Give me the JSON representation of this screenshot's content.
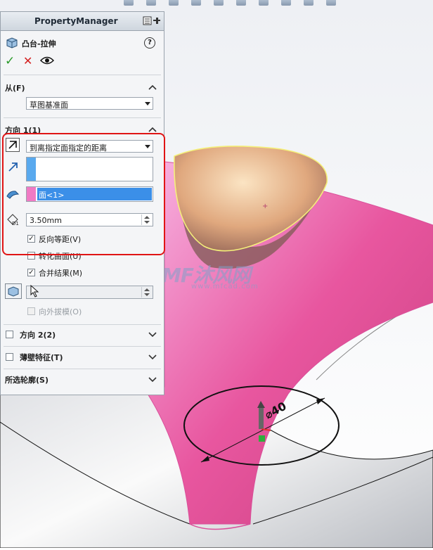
{
  "app": {
    "panel_title": "PropertyManager"
  },
  "feature": {
    "title": "凸台-拉伸"
  },
  "from": {
    "title": "从(F)",
    "selected": "草图基准面"
  },
  "direction1": {
    "title": "方向 1(1)",
    "end_condition": "到离指定面指定的距离",
    "face_selection": "面<1>",
    "offset_distance": "3.50mm",
    "reverse_offset_label": "反向等距(V)",
    "reverse_offset_checked": true
  },
  "options": {
    "translate_surface_label": "转化曲面(U)",
    "translate_surface_checked": false,
    "merge_result_label": "合并结果(M)",
    "merge_result_checked": true,
    "draft_outward_label": "向外拔模(O)",
    "draft_outward_checked": false
  },
  "direction2": {
    "title": "方向 2(2)",
    "checked": false
  },
  "thin_feature": {
    "title": "薄壁特征(T)",
    "checked": false
  },
  "selected_contours": {
    "title": "所选轮廓(S)"
  },
  "viewport": {
    "dimension_text": "⌀40",
    "watermark_logo": "MF沐风网",
    "watermark_url": "www.mfcad.com"
  },
  "colors": {
    "accent_red": "#e01515",
    "model_pink": "#ee6fc4",
    "face_yellow": "#e6c98c",
    "selection_blue": "#3b8fe8"
  }
}
